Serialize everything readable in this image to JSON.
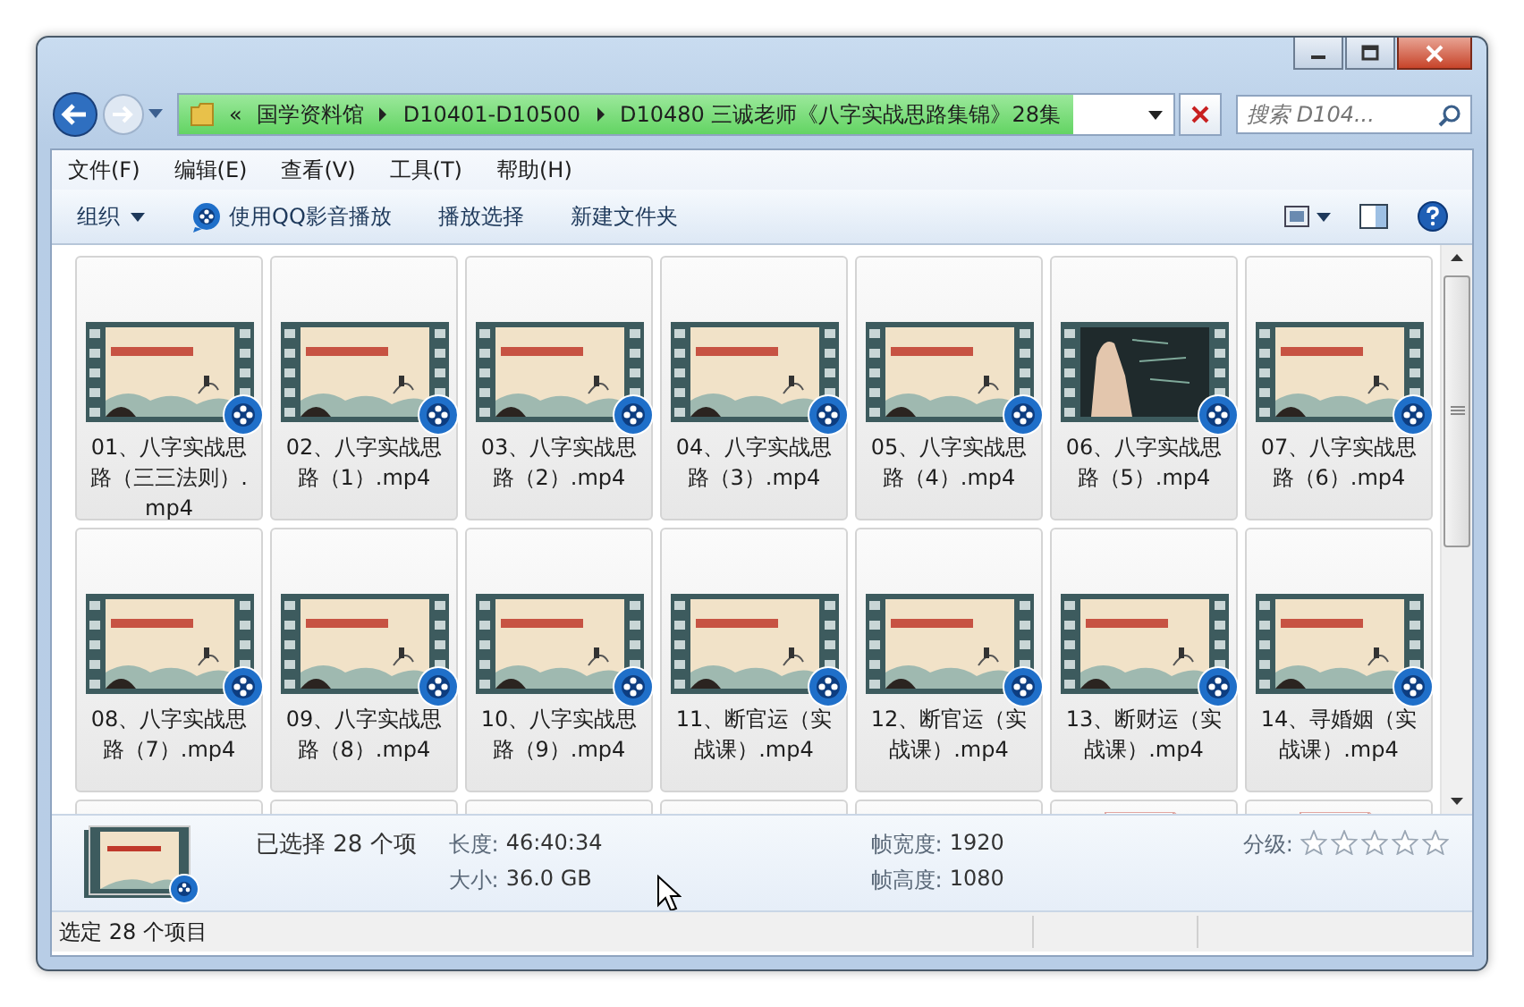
{
  "address_bar": {
    "overflow": "«",
    "crumbs": [
      "国学资料馆",
      "D10401-D10500",
      "D10480 三诚老师《八字实战思路集锦》28集"
    ],
    "level": 0.9
  },
  "search": {
    "placeholder": "搜索 D104..."
  },
  "menu": [
    "文件(F)",
    "编辑(E)",
    "查看(V)",
    "工具(T)",
    "帮助(H)"
  ],
  "toolbar": {
    "organize": "组织",
    "actions": [
      "使用QQ影音播放",
      "播放选择",
      "新建文件夹"
    ]
  },
  "files": [
    {
      "name": "01、八字实战思路（三三法则）.mp4",
      "kind": "scroll",
      "selected": true
    },
    {
      "name": "02、八字实战思路（1）.mp4",
      "kind": "scroll",
      "selected": true
    },
    {
      "name": "03、八字实战思路（2）.mp4",
      "kind": "scroll",
      "selected": true
    },
    {
      "name": "04、八字实战思路（3）.mp4",
      "kind": "scroll",
      "selected": true
    },
    {
      "name": "05、八字实战思路（4）.mp4",
      "kind": "scroll",
      "selected": true
    },
    {
      "name": "06、八字实战思路（5）.mp4",
      "kind": "blackboard",
      "selected": true
    },
    {
      "name": "07、八字实战思路（6）.mp4",
      "kind": "scroll",
      "selected": true
    },
    {
      "name": "08、八字实战思路（7）.mp4",
      "kind": "scroll",
      "selected": true
    },
    {
      "name": "09、八字实战思路（8）.mp4",
      "kind": "scroll",
      "selected": true
    },
    {
      "name": "10、八字实战思路（9）.mp4",
      "kind": "scroll",
      "selected": true
    },
    {
      "name": "11、断官运（实战课）.mp4",
      "kind": "scroll",
      "selected": true
    },
    {
      "name": "12、断官运（实战课）.mp4",
      "kind": "scroll",
      "selected": true
    },
    {
      "name": "13、断财运（实战课）.mp4",
      "kind": "scroll",
      "selected": true
    },
    {
      "name": "14、寻婚姻（实战课）.mp4",
      "kind": "scroll",
      "selected": true
    }
  ],
  "partial_tiles": [
    {
      "kind": "blank"
    },
    {
      "kind": "blank"
    },
    {
      "kind": "blank"
    },
    {
      "kind": "blank"
    },
    {
      "kind": "blank"
    },
    {
      "kind": "document"
    },
    {
      "kind": "document"
    }
  ],
  "details": {
    "summary": "已选择 28 个项",
    "fields": [
      {
        "label": "长度:",
        "value": "46:40:34"
      },
      {
        "label": "帧宽度:",
        "value": "1920"
      },
      {
        "label": "大小:",
        "value": "36.0 GB"
      },
      {
        "label": "帧高度:",
        "value": "1080"
      }
    ],
    "rating": {
      "label": "分级:",
      "stars": 0
    }
  },
  "status_bar": "选定 28 个项目"
}
